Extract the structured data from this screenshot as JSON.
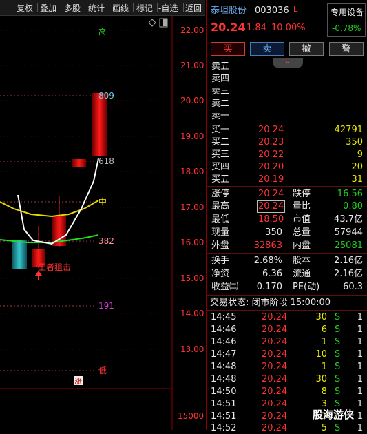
{
  "toolbar": {
    "items": [
      "复权",
      "叠加",
      "多股",
      "统计",
      "画线",
      "标记",
      "-自选",
      "返回"
    ]
  },
  "chart": {
    "axis_labels": [
      "22.00",
      "21.00",
      "20.00",
      "19.00",
      "18.00",
      "17.00",
      "16.00",
      "15.00",
      "14.00",
      "13.00",
      "15000"
    ],
    "markers": {
      "m809": "809",
      "m618": "618",
      "mid": "中",
      "m382": "382",
      "m191": "191",
      "low": "低",
      "top": "高"
    },
    "annotation": "王者狙击",
    "rise_badge": "涨"
  },
  "header": {
    "name": "泰坦股份",
    "code": "003036",
    "device": "专用设备",
    "price": "20.24",
    "change": "1.84",
    "pct": "10.00%",
    "device_pct": "-0.78%"
  },
  "buttons": {
    "buy": "买",
    "sell": "卖",
    "cancel": "撤",
    "alert": "警"
  },
  "asks": [
    "卖五",
    "卖四",
    "卖三",
    "卖二",
    "卖一"
  ],
  "bids": [
    {
      "label": "买一",
      "price": "20.24",
      "vol": "42791"
    },
    {
      "label": "买二",
      "price": "20.23",
      "vol": "350"
    },
    {
      "label": "买三",
      "price": "20.22",
      "vol": "9"
    },
    {
      "label": "买四",
      "price": "20.20",
      "vol": "20"
    },
    {
      "label": "买五",
      "price": "20.19",
      "vol": "31"
    }
  ],
  "stats": {
    "zt_l": "涨停",
    "zt_v": "20.24",
    "dt_l": "跌停",
    "dt_v": "16.56",
    "zg_l": "最高",
    "zg_v": "20.24",
    "lb_l": "量比",
    "lb_v": "0.80",
    "zd_l": "最低",
    "zd_v": "18.50",
    "sz_l": "市值",
    "sz_v": "43.7亿",
    "xl_l": "现量",
    "xl_v": "350",
    "zl_l": "总量",
    "zl_v": "57944",
    "wp_l": "外盘",
    "wp_v": "32863",
    "np_l": "内盘",
    "np_v": "25081",
    "hs_l": "换手",
    "hs_v": "2.68%",
    "gb_l": "股本",
    "gb_v": "2.16亿",
    "jz_l": "净资",
    "jz_v": "6.36",
    "lt_l": "流通",
    "lt_v": "2.16亿",
    "sy_l": "收益㈡",
    "sy_v": "0.170",
    "pe_l": "PE(动)",
    "pe_v": "60.3"
  },
  "status": "交易状态: 闭市阶段 15:00:00",
  "ticks": [
    {
      "t": "14:45",
      "p": "20.24",
      "v": "30",
      "s": "S",
      "n": "1"
    },
    {
      "t": "14:46",
      "p": "20.24",
      "v": "6",
      "s": "S",
      "n": "1"
    },
    {
      "t": "14:46",
      "p": "20.24",
      "v": "1",
      "s": "S",
      "n": "1"
    },
    {
      "t": "14:47",
      "p": "20.24",
      "v": "10",
      "s": "S",
      "n": "1"
    },
    {
      "t": "14:48",
      "p": "20.24",
      "v": "1",
      "s": "S",
      "n": "1"
    },
    {
      "t": "14:48",
      "p": "20.24",
      "v": "30",
      "s": "S",
      "n": "1"
    },
    {
      "t": "14:50",
      "p": "20.24",
      "v": "8",
      "s": "S",
      "n": "1"
    },
    {
      "t": "14:51",
      "p": "20.24",
      "v": "3",
      "s": "S",
      "n": "1"
    },
    {
      "t": "14:51",
      "p": "20.24",
      "v": "1",
      "s": "S",
      "n": "1"
    },
    {
      "t": "14:52",
      "p": "20.24",
      "v": "5",
      "s": "S",
      "n": "1"
    }
  ],
  "watermark": "股海游侠"
}
